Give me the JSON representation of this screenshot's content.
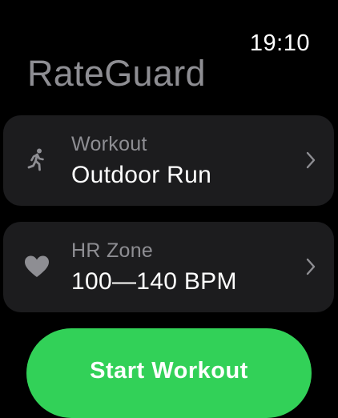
{
  "status": {
    "time": "19:10"
  },
  "app": {
    "title": "RateGuard"
  },
  "workout": {
    "label": "Workout",
    "value": "Outdoor Run",
    "icon": "running-figure-icon"
  },
  "hr_zone": {
    "label": "HR Zone",
    "value": "100—140 BPM",
    "icon": "heart-icon"
  },
  "start": {
    "label": "Start Workout"
  },
  "colors": {
    "background": "#000000",
    "card": "#1c1c1e",
    "secondary_text": "#8e8e93",
    "accent_green": "#32d158",
    "primary_text": "#ffffff"
  }
}
